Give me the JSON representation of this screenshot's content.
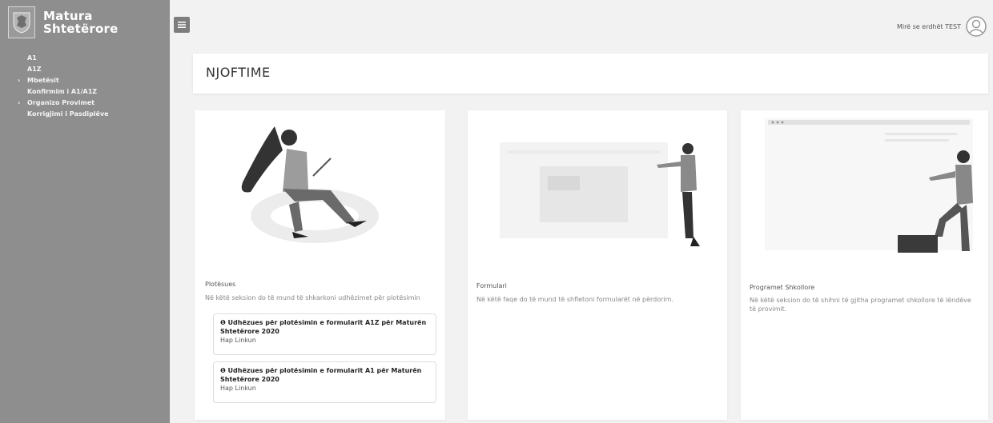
{
  "brand": {
    "line1": "Matura",
    "line2": "Shtetërore"
  },
  "sidebar": {
    "items": [
      {
        "label": "A1",
        "caret": ""
      },
      {
        "label": "A1Z",
        "caret": ""
      },
      {
        "label": "Mbetësit",
        "caret": "›"
      },
      {
        "label": "Konfirmim i A1/A1Z",
        "caret": ""
      },
      {
        "label": "Organizo Provimet",
        "caret": "›"
      },
      {
        "label": "Korrigjimi i Pasdiplëve",
        "caret": ""
      }
    ]
  },
  "header": {
    "greeting": "Mirë se erdhët TEST"
  },
  "page": {
    "title": "NJOFTIME"
  },
  "cards": [
    {
      "label": "Plotësues",
      "description": "Në këtë seksion do të mund të shkarkoni udhëzimet për plotësimin",
      "guides": [
        {
          "title": "❶ Udhëzues për plotësimin e formularit A1Z për Maturën Shtetërore 2020",
          "link": "Hap Linkun"
        },
        {
          "title": "❶ Udhëzues për plotësimin e formularit A1 për Maturën Shtetërore 2020",
          "link": "Hap Linkun"
        }
      ]
    },
    {
      "label": "Formulari",
      "description": "Në këtë faqe do të mund të shfletoni formularët në përdorim."
    },
    {
      "label": "Programet Shkollore",
      "description": "Në këtë seksion do të shihni të gjitha programet shkollore të lëndëve të provimit."
    }
  ]
}
